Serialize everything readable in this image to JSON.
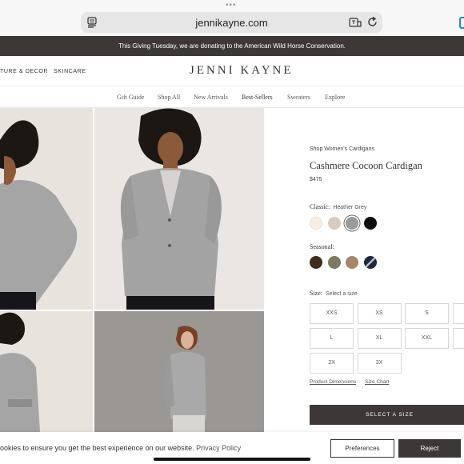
{
  "browser": {
    "url": "jennikayne.com",
    "dots": "•••",
    "icons": [
      "reader-icon",
      "translate-icon",
      "reload-icon"
    ]
  },
  "announcement": "This Giving Tuesday, we are donating to the American Wild Horse Conservation.",
  "header": {
    "left_links": [
      "TURE & DECOR",
      "SKINCARE"
    ],
    "logo": "JENNI KAYNE"
  },
  "nav": [
    "Gift Guide",
    "Shop All",
    "New Arrivals",
    "Best-Sellers",
    "Sweaters",
    "Explore"
  ],
  "product": {
    "breadcrumb": "Shop Women's Cardigans",
    "title": "Cashmere Cocoon Cardigan",
    "price": "$475",
    "classic_label": "Classic:",
    "classic_selected": "Heather Grey",
    "classic_swatches": [
      {
        "name": "swatch-ivory",
        "color": "#f7efe6"
      },
      {
        "name": "swatch-oatmeal",
        "color": "#d8cbc1"
      },
      {
        "name": "swatch-heather-grey",
        "color": "#9a9a9a",
        "selected": true
      },
      {
        "name": "swatch-black",
        "color": "#0d0d0d"
      }
    ],
    "seasonal_label": "Seasonal:",
    "seasonal_swatches": [
      {
        "name": "swatch-chocolate",
        "color": "#3f2a1c"
      },
      {
        "name": "swatch-olive",
        "color": "#7b7a62"
      },
      {
        "name": "swatch-camel",
        "color": "#a88369"
      },
      {
        "name": "swatch-navy-stripe",
        "color": "#1c2841"
      }
    ],
    "size_label": "Size:",
    "size_prompt": "Select a size",
    "sizes": [
      "XXS",
      "XS",
      "S",
      "",
      "L",
      "XL",
      "XXL",
      "",
      "2X",
      "3X"
    ],
    "links": [
      "Product Dimensions",
      "Size Chart"
    ],
    "cta": "SELECT A SIZE"
  },
  "cookie": {
    "text": "ookies to ensure you get the best experience on our website.",
    "link": "Privacy Policy",
    "preferences": "Preferences",
    "reject": "Reject"
  },
  "colors": {
    "dark": "#3d3835",
    "border": "#d7d7d7"
  }
}
